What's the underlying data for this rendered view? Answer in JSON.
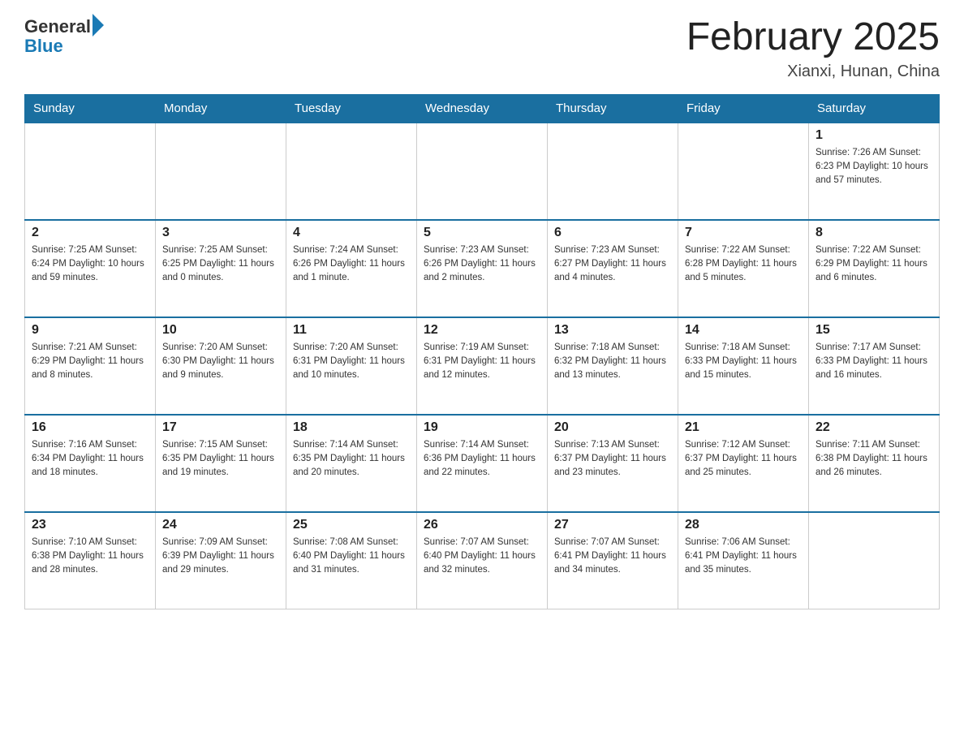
{
  "logo": {
    "general": "General",
    "blue": "Blue"
  },
  "header": {
    "month_year": "February 2025",
    "location": "Xianxi, Hunan, China"
  },
  "weekdays": [
    "Sunday",
    "Monday",
    "Tuesday",
    "Wednesday",
    "Thursday",
    "Friday",
    "Saturday"
  ],
  "weeks": [
    [
      {
        "day": "",
        "info": ""
      },
      {
        "day": "",
        "info": ""
      },
      {
        "day": "",
        "info": ""
      },
      {
        "day": "",
        "info": ""
      },
      {
        "day": "",
        "info": ""
      },
      {
        "day": "",
        "info": ""
      },
      {
        "day": "1",
        "info": "Sunrise: 7:26 AM\nSunset: 6:23 PM\nDaylight: 10 hours\nand 57 minutes."
      }
    ],
    [
      {
        "day": "2",
        "info": "Sunrise: 7:25 AM\nSunset: 6:24 PM\nDaylight: 10 hours\nand 59 minutes."
      },
      {
        "day": "3",
        "info": "Sunrise: 7:25 AM\nSunset: 6:25 PM\nDaylight: 11 hours\nand 0 minutes."
      },
      {
        "day": "4",
        "info": "Sunrise: 7:24 AM\nSunset: 6:26 PM\nDaylight: 11 hours\nand 1 minute."
      },
      {
        "day": "5",
        "info": "Sunrise: 7:23 AM\nSunset: 6:26 PM\nDaylight: 11 hours\nand 2 minutes."
      },
      {
        "day": "6",
        "info": "Sunrise: 7:23 AM\nSunset: 6:27 PM\nDaylight: 11 hours\nand 4 minutes."
      },
      {
        "day": "7",
        "info": "Sunrise: 7:22 AM\nSunset: 6:28 PM\nDaylight: 11 hours\nand 5 minutes."
      },
      {
        "day": "8",
        "info": "Sunrise: 7:22 AM\nSunset: 6:29 PM\nDaylight: 11 hours\nand 6 minutes."
      }
    ],
    [
      {
        "day": "9",
        "info": "Sunrise: 7:21 AM\nSunset: 6:29 PM\nDaylight: 11 hours\nand 8 minutes."
      },
      {
        "day": "10",
        "info": "Sunrise: 7:20 AM\nSunset: 6:30 PM\nDaylight: 11 hours\nand 9 minutes."
      },
      {
        "day": "11",
        "info": "Sunrise: 7:20 AM\nSunset: 6:31 PM\nDaylight: 11 hours\nand 10 minutes."
      },
      {
        "day": "12",
        "info": "Sunrise: 7:19 AM\nSunset: 6:31 PM\nDaylight: 11 hours\nand 12 minutes."
      },
      {
        "day": "13",
        "info": "Sunrise: 7:18 AM\nSunset: 6:32 PM\nDaylight: 11 hours\nand 13 minutes."
      },
      {
        "day": "14",
        "info": "Sunrise: 7:18 AM\nSunset: 6:33 PM\nDaylight: 11 hours\nand 15 minutes."
      },
      {
        "day": "15",
        "info": "Sunrise: 7:17 AM\nSunset: 6:33 PM\nDaylight: 11 hours\nand 16 minutes."
      }
    ],
    [
      {
        "day": "16",
        "info": "Sunrise: 7:16 AM\nSunset: 6:34 PM\nDaylight: 11 hours\nand 18 minutes."
      },
      {
        "day": "17",
        "info": "Sunrise: 7:15 AM\nSunset: 6:35 PM\nDaylight: 11 hours\nand 19 minutes."
      },
      {
        "day": "18",
        "info": "Sunrise: 7:14 AM\nSunset: 6:35 PM\nDaylight: 11 hours\nand 20 minutes."
      },
      {
        "day": "19",
        "info": "Sunrise: 7:14 AM\nSunset: 6:36 PM\nDaylight: 11 hours\nand 22 minutes."
      },
      {
        "day": "20",
        "info": "Sunrise: 7:13 AM\nSunset: 6:37 PM\nDaylight: 11 hours\nand 23 minutes."
      },
      {
        "day": "21",
        "info": "Sunrise: 7:12 AM\nSunset: 6:37 PM\nDaylight: 11 hours\nand 25 minutes."
      },
      {
        "day": "22",
        "info": "Sunrise: 7:11 AM\nSunset: 6:38 PM\nDaylight: 11 hours\nand 26 minutes."
      }
    ],
    [
      {
        "day": "23",
        "info": "Sunrise: 7:10 AM\nSunset: 6:38 PM\nDaylight: 11 hours\nand 28 minutes."
      },
      {
        "day": "24",
        "info": "Sunrise: 7:09 AM\nSunset: 6:39 PM\nDaylight: 11 hours\nand 29 minutes."
      },
      {
        "day": "25",
        "info": "Sunrise: 7:08 AM\nSunset: 6:40 PM\nDaylight: 11 hours\nand 31 minutes."
      },
      {
        "day": "26",
        "info": "Sunrise: 7:07 AM\nSunset: 6:40 PM\nDaylight: 11 hours\nand 32 minutes."
      },
      {
        "day": "27",
        "info": "Sunrise: 7:07 AM\nSunset: 6:41 PM\nDaylight: 11 hours\nand 34 minutes."
      },
      {
        "day": "28",
        "info": "Sunrise: 7:06 AM\nSunset: 6:41 PM\nDaylight: 11 hours\nand 35 minutes."
      },
      {
        "day": "",
        "info": ""
      }
    ]
  ]
}
